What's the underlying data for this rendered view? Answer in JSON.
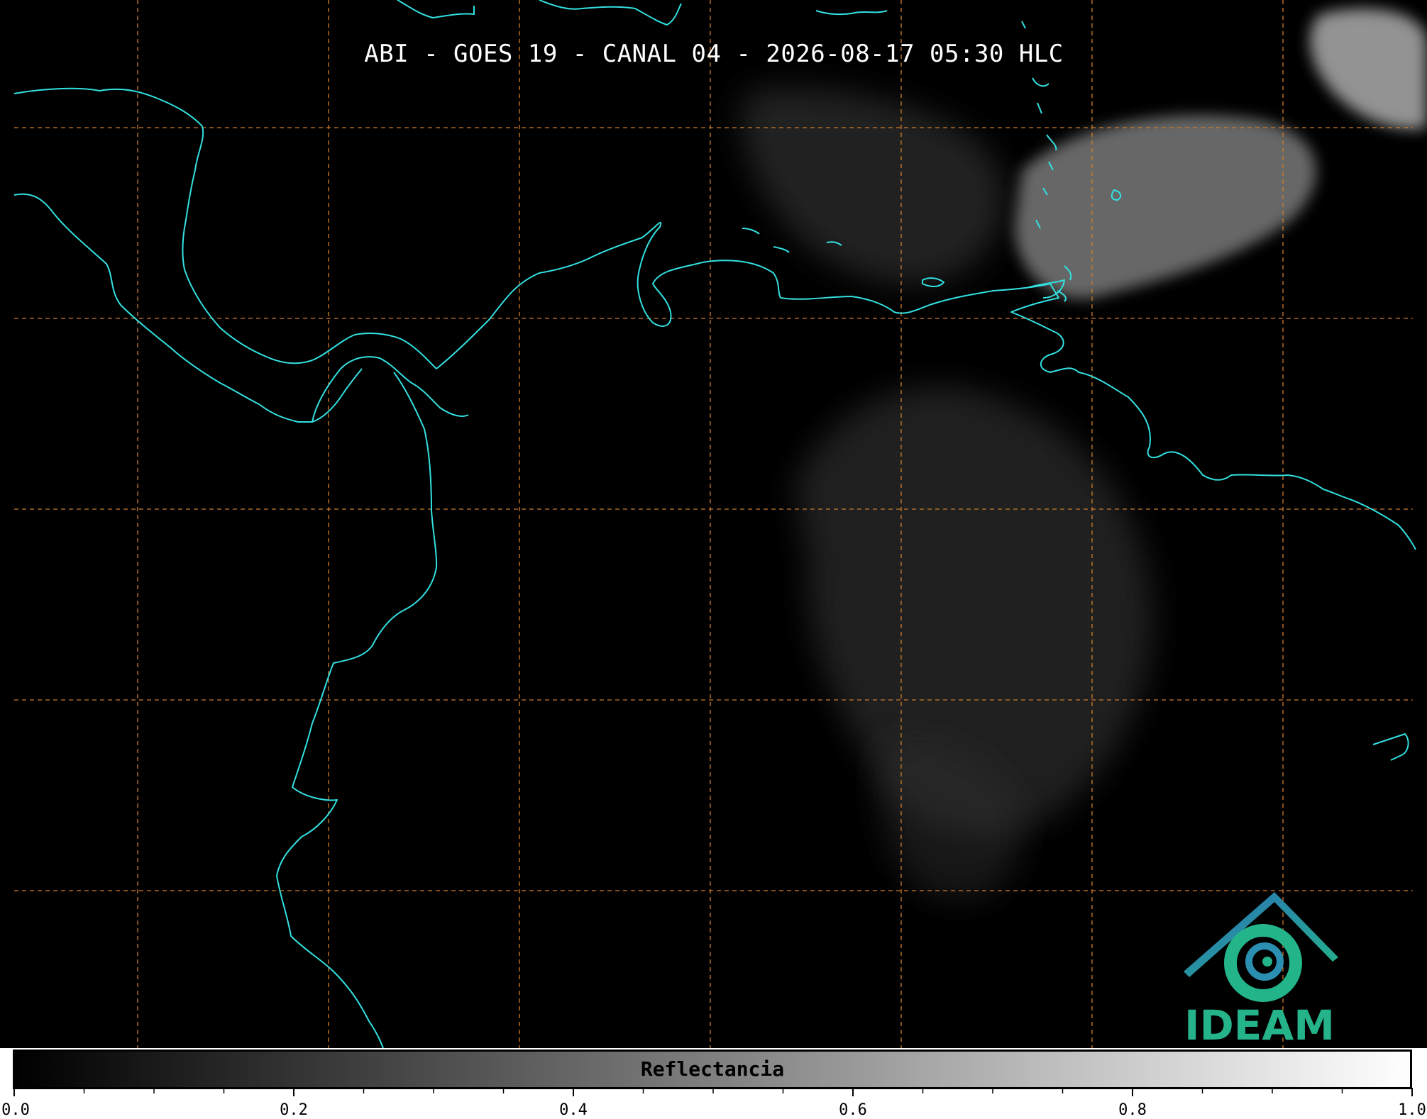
{
  "map": {
    "title": "ABI - GOES 19 - CANAL 04 - 2026-08-17 05:30 HLC",
    "background_color": "#000000",
    "coastline_color": "#33e0e0",
    "gridline_color": "#d07a2a",
    "gridline_style": "dashed"
  },
  "colorbar": {
    "label": "Reflectancia",
    "range": [
      0.0,
      1.0
    ],
    "colormap": "gray",
    "ticks": [
      "0.0",
      "0.2",
      "0.4",
      "0.6",
      "0.8",
      "1.0"
    ]
  },
  "logo": {
    "text": "IDEAM",
    "color": "#25b38a"
  }
}
